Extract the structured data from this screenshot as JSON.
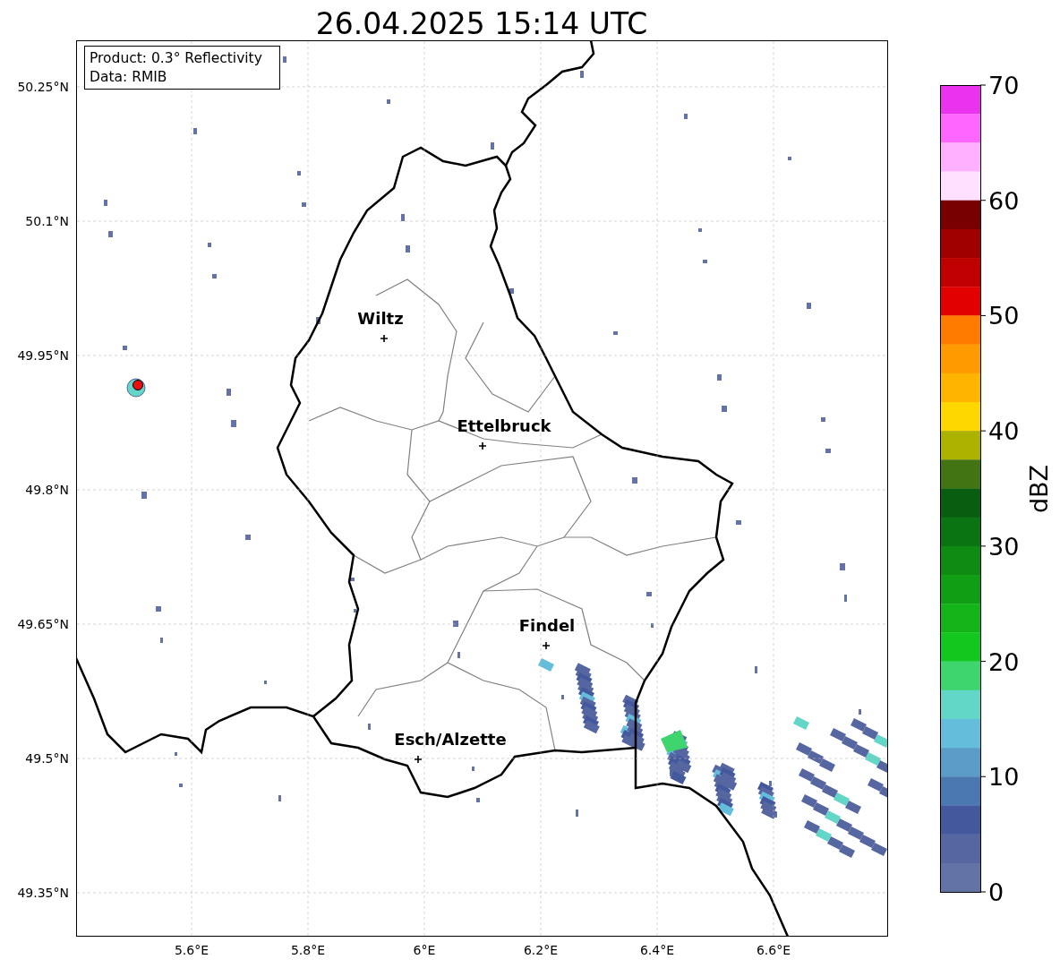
{
  "title": "26.04.2025 15:14 UTC",
  "info_box": [
    "Product: 0.3° Reflectivity",
    "Data: RMIB"
  ],
  "lat_ticks": [
    "50.25°N",
    "50.1°N",
    "49.95°N",
    "49.8°N",
    "49.65°N",
    "49.5°N",
    "49.35°N"
  ],
  "lon_ticks": [
    "5.6°E",
    "5.8°E",
    "6°E",
    "6.2°E",
    "6.4°E",
    "6.6°E"
  ],
  "cities": [
    {
      "name": "Wiltz"
    },
    {
      "name": "Ettelbruck"
    },
    {
      "name": "Findel"
    },
    {
      "name": "Esch/Alzette"
    }
  ],
  "colorbar": {
    "label": "dBZ",
    "ticks": [
      "70",
      "60",
      "50",
      "40",
      "30",
      "20",
      "10",
      "0"
    ],
    "bins": [
      {
        "color": "#ea33ee"
      },
      {
        "color": "#ff66ff"
      },
      {
        "color": "#ffb0ff"
      },
      {
        "color": "#ffe0ff"
      },
      {
        "color": "#780000"
      },
      {
        "color": "#a00000"
      },
      {
        "color": "#c00000"
      },
      {
        "color": "#e30000"
      },
      {
        "color": "#ff7c00"
      },
      {
        "color": "#ff9a00"
      },
      {
        "color": "#ffb400"
      },
      {
        "color": "#ffd700"
      },
      {
        "color": "#adb200"
      },
      {
        "color": "#437414"
      },
      {
        "color": "#085d10"
      },
      {
        "color": "#0a7412"
      },
      {
        "color": "#0f8a12"
      },
      {
        "color": "#109e14"
      },
      {
        "color": "#12b418"
      },
      {
        "color": "#12c81e"
      },
      {
        "color": "#3ed46e"
      },
      {
        "color": "#62d6c7"
      },
      {
        "color": "#64bedb"
      },
      {
        "color": "#5a9bc8"
      },
      {
        "color": "#4b78b0"
      },
      {
        "color": "#44589e"
      },
      {
        "color": "#5666a0"
      },
      {
        "color": "#6373a6"
      }
    ]
  }
}
